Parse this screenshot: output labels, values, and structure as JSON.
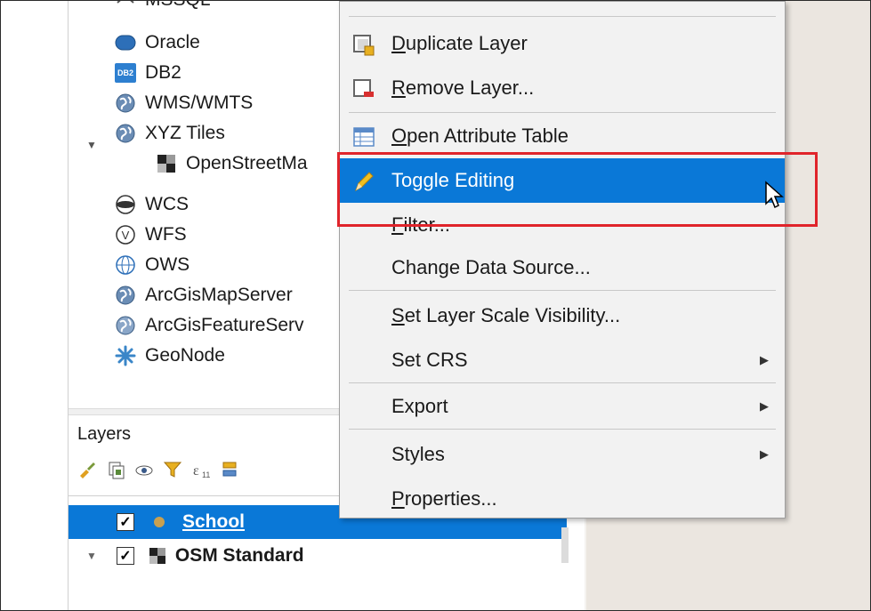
{
  "browser": {
    "items": [
      {
        "label": "MSSQL",
        "icon": "mssql-icon"
      },
      {
        "label": "Oracle",
        "icon": "oracle-icon"
      },
      {
        "label": "DB2",
        "icon": "db2-icon"
      },
      {
        "label": "WMS/WMTS",
        "icon": "globe-icon"
      },
      {
        "label": "XYZ Tiles",
        "icon": "globe-icon"
      },
      {
        "label": "OpenStreetMa",
        "icon": "tiles-icon"
      },
      {
        "label": "WCS",
        "icon": "wcs-icon"
      },
      {
        "label": "WFS",
        "icon": "wfs-icon"
      },
      {
        "label": "OWS",
        "icon": "ows-icon"
      },
      {
        "label": "ArcGisMapServer",
        "icon": "globe-icon"
      },
      {
        "label": "ArcGisFeatureServ",
        "icon": "globe-icon"
      },
      {
        "label": "GeoNode",
        "icon": "geonode-icon"
      }
    ],
    "db2_badge": "DB2"
  },
  "layers": {
    "title": "Layers",
    "rows": [
      {
        "label": "School",
        "checked": "✓"
      },
      {
        "label": "OSM Standard",
        "checked": "✓"
      }
    ]
  },
  "menu": {
    "items": [
      {
        "label": "Duplicate Layer",
        "mnemonic": "D",
        "rest": "uplicate Layer"
      },
      {
        "label": "Remove Layer...",
        "mnemonic": "R",
        "rest": "emove Layer..."
      },
      {
        "label": "Open Attribute Table",
        "mnemonic": "O",
        "rest": "pen Attribute Table"
      },
      {
        "label": "Toggle Editing"
      },
      {
        "label": "Filter...",
        "mnemonic": "F",
        "rest": "ilter..."
      },
      {
        "label": "Change Data Source..."
      },
      {
        "label": "Set Layer Scale Visibility...",
        "mnemonic": "S",
        "rest": "et Layer Scale Visibility..."
      },
      {
        "label": "Set CRS"
      },
      {
        "label": "Export"
      },
      {
        "label": "Styles"
      },
      {
        "label": "Properties...",
        "mnemonic": "P",
        "rest": "roperties..."
      }
    ],
    "submenu_arrow": "▶"
  },
  "colors": {
    "selection": "#0a78d7",
    "highlight_box": "#e0242b",
    "map_background": "#ebe6e0"
  }
}
